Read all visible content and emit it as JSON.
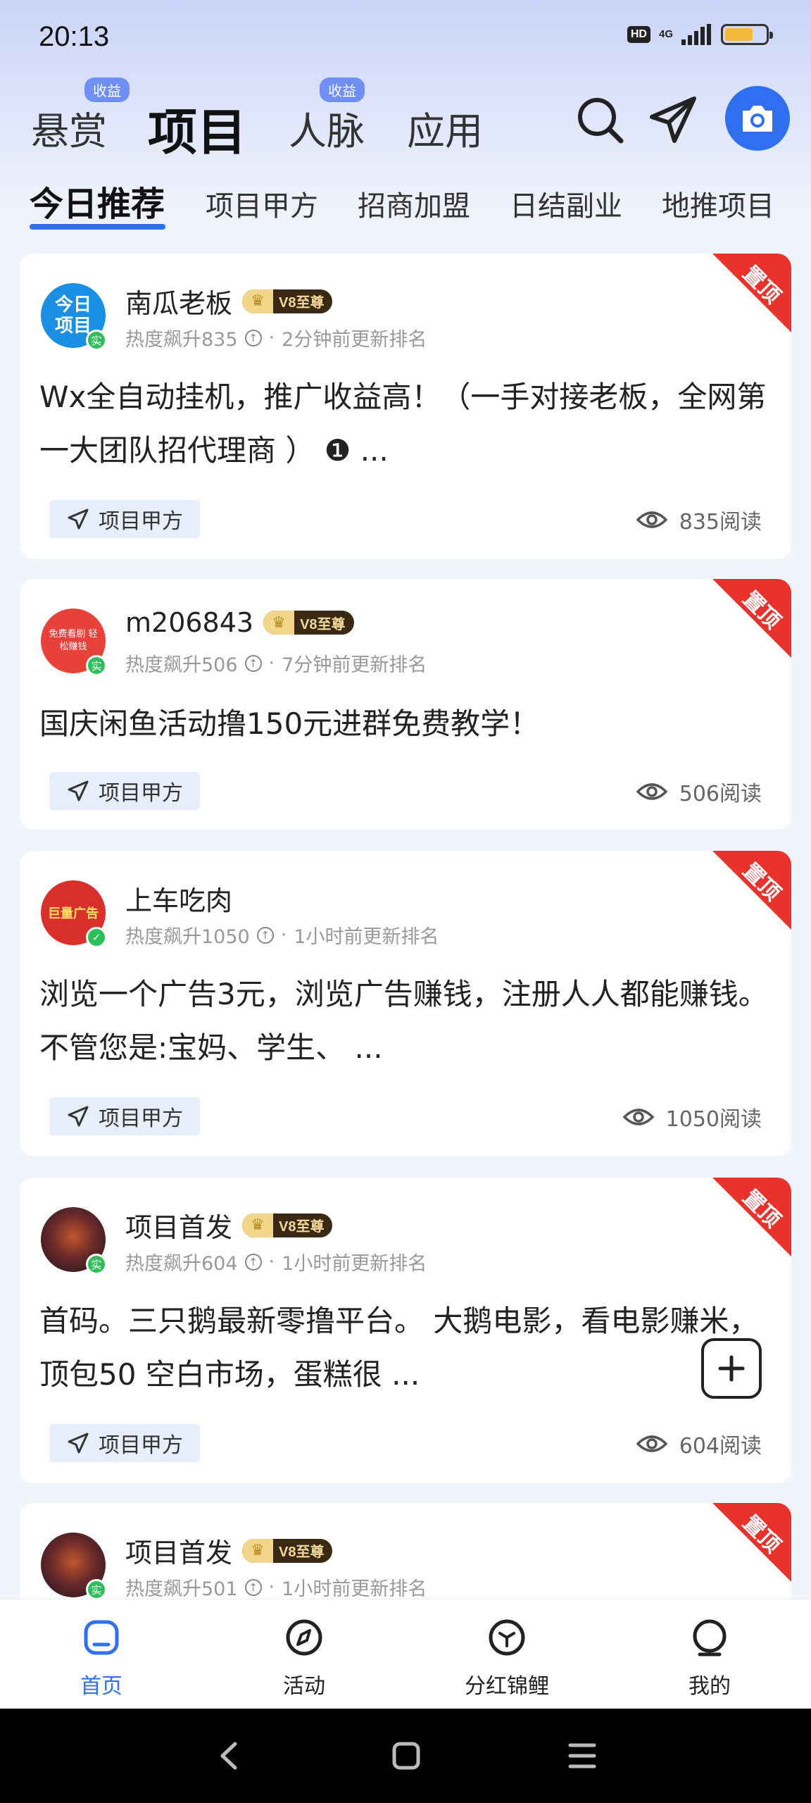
{
  "status_bar": {
    "time": "20:13",
    "hd": "HD",
    "network": "4G"
  },
  "header": {
    "tabs": [
      {
        "label": "悬赏",
        "badge": "收益",
        "active": false
      },
      {
        "label": "项目",
        "badge": "",
        "active": true
      },
      {
        "label": "人脉",
        "badge": "收益",
        "active": false
      },
      {
        "label": "应用",
        "badge": "",
        "active": false
      }
    ],
    "icons": [
      "search-icon",
      "send-icon",
      "camera-icon"
    ]
  },
  "subtabs": [
    "今日推荐",
    "项目甲方",
    "招商加盟",
    "日结副业",
    "地推项目"
  ],
  "accent_color": "#2f6ff0",
  "pin_label": "置顶",
  "verified_label": "实",
  "posts": [
    {
      "author": "南瓜老板",
      "vip": "V8至尊",
      "heat": "热度飙升835",
      "updated": "2分钟前更新排名",
      "content": "Wx全自动挂机，推广收益高！（一手对接老板，全网第一大团队招代理商 ） ❶ ...",
      "tag": "项目甲方",
      "views": "835阅读",
      "avatar_text": "今日项目"
    },
    {
      "author": "m206843",
      "vip": "V8至尊",
      "heat": "热度飙升506",
      "updated": "7分钟前更新排名",
      "content": "国庆闲鱼活动撸150元进群免费教学！",
      "tag": "项目甲方",
      "views": "506阅读",
      "avatar_text": "免费看剧 轻松赚钱"
    },
    {
      "author": "上车吃肉",
      "vip": "",
      "heat": "热度飙升1050",
      "updated": "1小时前更新排名",
      "content": "浏览一个广告3元，浏览广告赚钱，注册人人都能赚钱。 不管您是:宝妈、学生、 ...",
      "tag": "项目甲方",
      "views": "1050阅读",
      "avatar_text": "巨量广告"
    },
    {
      "author": "项目首发",
      "vip": "V8至尊",
      "heat": "热度飙升604",
      "updated": "1小时前更新排名",
      "content": "首码。三只鹅最新零撸平台。 大鹅电影，看电影赚米，顶包50 空白市场，蛋糕很 ...",
      "tag": "项目甲方",
      "views": "604阅读",
      "avatar_text": ""
    },
    {
      "author": "项目首发",
      "vip": "V8至尊",
      "heat": "热度飙升501",
      "updated": "1小时前更新排名",
      "content": "",
      "tag": "",
      "views": "",
      "avatar_text": ""
    }
  ],
  "bottom_nav": [
    {
      "label": "首页",
      "icon": "home-icon",
      "active": true
    },
    {
      "label": "活动",
      "icon": "compass-icon",
      "active": false
    },
    {
      "label": "分红锦鲤",
      "icon": "cube-icon",
      "active": false
    },
    {
      "label": "我的",
      "icon": "profile-icon",
      "active": false
    }
  ]
}
